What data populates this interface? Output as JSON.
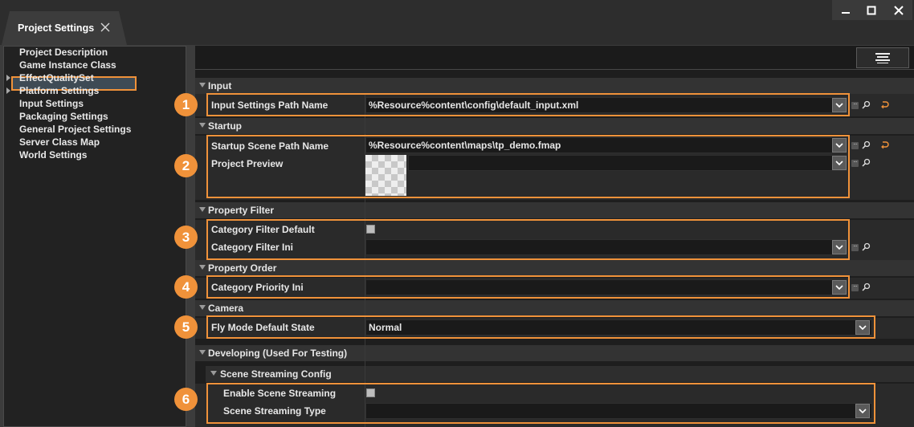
{
  "tab": {
    "title": "Project Settings"
  },
  "window_controls": [
    "minimize",
    "maximize",
    "close"
  ],
  "sidebar": {
    "items": [
      {
        "label": "Project Description",
        "expandable": false,
        "selected": false
      },
      {
        "label": "Game Instance Class",
        "expandable": false,
        "selected": false
      },
      {
        "label": "EffectQualitySet",
        "expandable": true,
        "selected": false
      },
      {
        "label": "Platform Settings",
        "expandable": true,
        "selected": false
      },
      {
        "label": "Input Settings",
        "expandable": false,
        "selected": false
      },
      {
        "label": "Packaging Settings",
        "expandable": false,
        "selected": false
      },
      {
        "label": "General Project Settings",
        "expandable": false,
        "selected": true
      },
      {
        "label": "Server Class Map",
        "expandable": false,
        "selected": false
      },
      {
        "label": "World Settings",
        "expandable": false,
        "selected": false
      }
    ]
  },
  "sections": {
    "input": {
      "title": "Input",
      "input_settings_path": {
        "label": "Input Settings Path Name",
        "value": "%Resource%content\\config\\default_input.xml"
      }
    },
    "startup": {
      "title": "Startup",
      "startup_scene_path": {
        "label": "Startup Scene Path Name",
        "value": "%Resource%content\\maps\\tp_demo.fmap"
      },
      "project_preview": {
        "label": "Project Preview",
        "value": ""
      }
    },
    "property_filter": {
      "title": "Property Filter",
      "category_filter_default": {
        "label": "Category Filter Default",
        "checked": false
      },
      "category_filter_ini": {
        "label": "Category Filter Ini",
        "value": ""
      }
    },
    "property_order": {
      "title": "Property Order",
      "category_priority_ini": {
        "label": "Category Priority Ini",
        "value": ""
      }
    },
    "camera": {
      "title": "Camera",
      "fly_mode_default_state": {
        "label": "Fly Mode Default State",
        "value": "Normal"
      }
    },
    "developing": {
      "title": "Developing (Used For Testing)",
      "scene_streaming_config": {
        "title": "Scene Streaming Config",
        "enable_scene_streaming": {
          "label": "Enable Scene Streaming",
          "checked": false
        },
        "scene_streaming_type": {
          "label": "Scene Streaming Type",
          "value": ""
        }
      }
    }
  },
  "callouts": [
    "1",
    "2",
    "3",
    "4",
    "5",
    "6"
  ],
  "colors": {
    "highlight": "#f0923a",
    "background": "#1e1e1e",
    "panel": "#222222"
  }
}
